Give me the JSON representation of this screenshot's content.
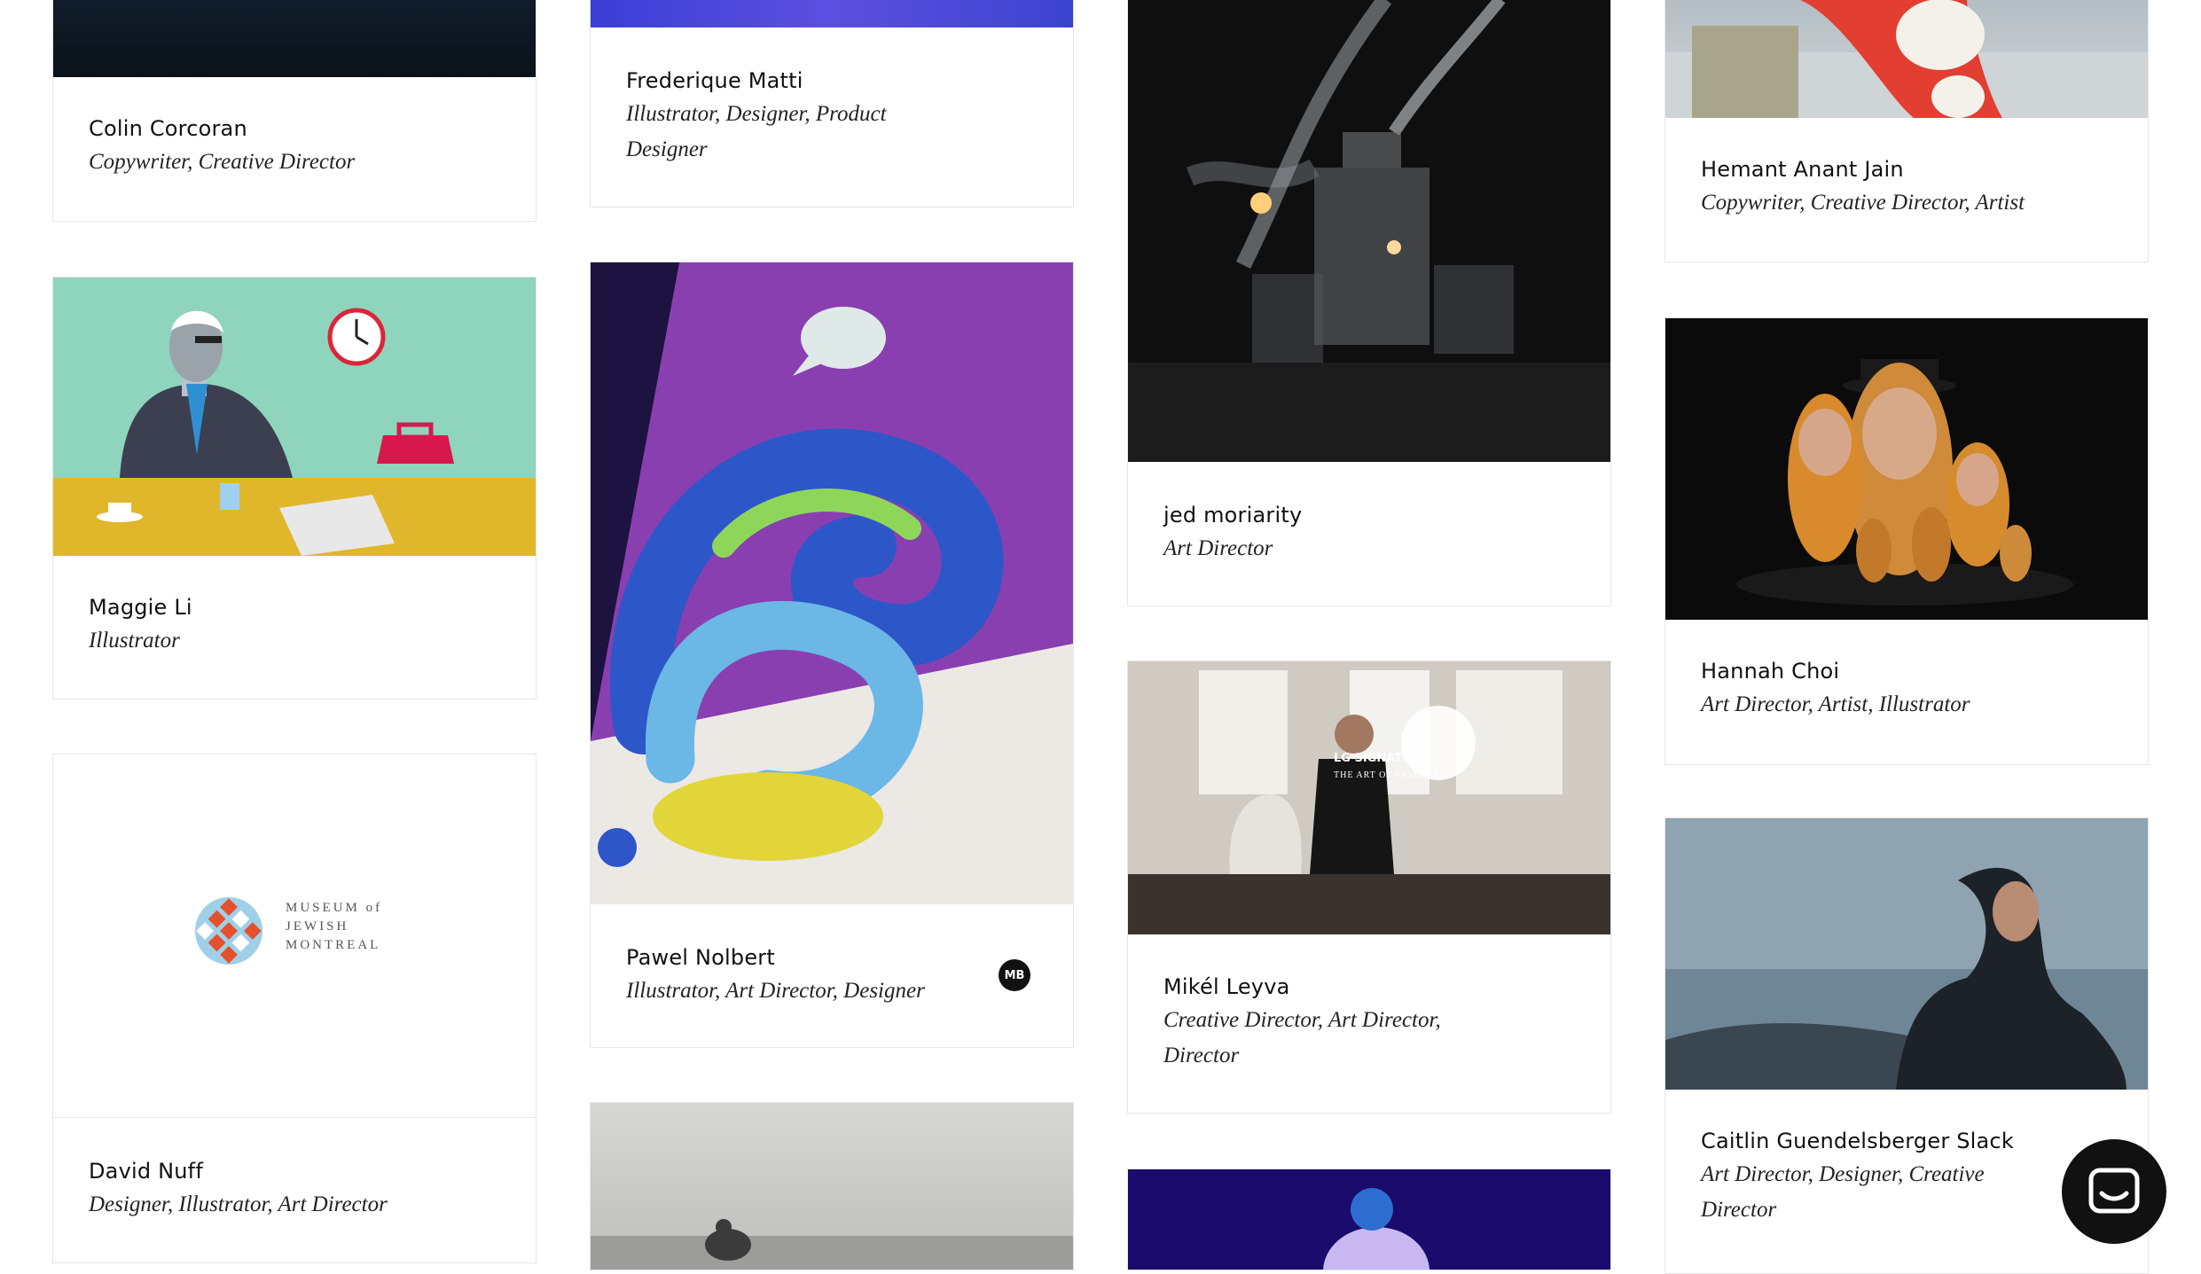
{
  "cards": [
    {
      "name": "Colin Corcoran",
      "role": "Copywriter, Creative Director"
    },
    {
      "name": "Maggie Li",
      "role": "Illustrator"
    },
    {
      "name": "David Nuff",
      "role": "Designer, Illustrator, Art Director",
      "logo_lines": [
        "MUSEUM of",
        "JEWISH",
        "MONTREAL"
      ]
    },
    {
      "name": "Frederique Matti",
      "role_lines": [
        "Illustrator, Designer, Product",
        "Designer"
      ]
    },
    {
      "name": "Pawel Nolbert",
      "role": "Illustrator, Art Director, Designer",
      "badge": "MB"
    },
    {
      "name": "jed moriarity",
      "role": "Art Director"
    },
    {
      "name": "Mikél Leyva",
      "role_lines": [
        "Creative Director, Art Director,",
        "Director"
      ],
      "overlay_brand": "LG SIGNATURE",
      "overlay_sub": "THE ART OF ESSENCE"
    },
    {
      "name": "Hemant Anant Jain",
      "role": "Copywriter, Creative Director, Artist"
    },
    {
      "name": "Hannah Choi",
      "role": "Art Director, Artist, Illustrator"
    },
    {
      "name": "Caitlin Guendelsberger Slack",
      "role_lines": [
        "Art Director, Designer, Creative",
        "Director"
      ]
    }
  ],
  "chat_button": {
    "icon": "chat-bubble-icon"
  }
}
